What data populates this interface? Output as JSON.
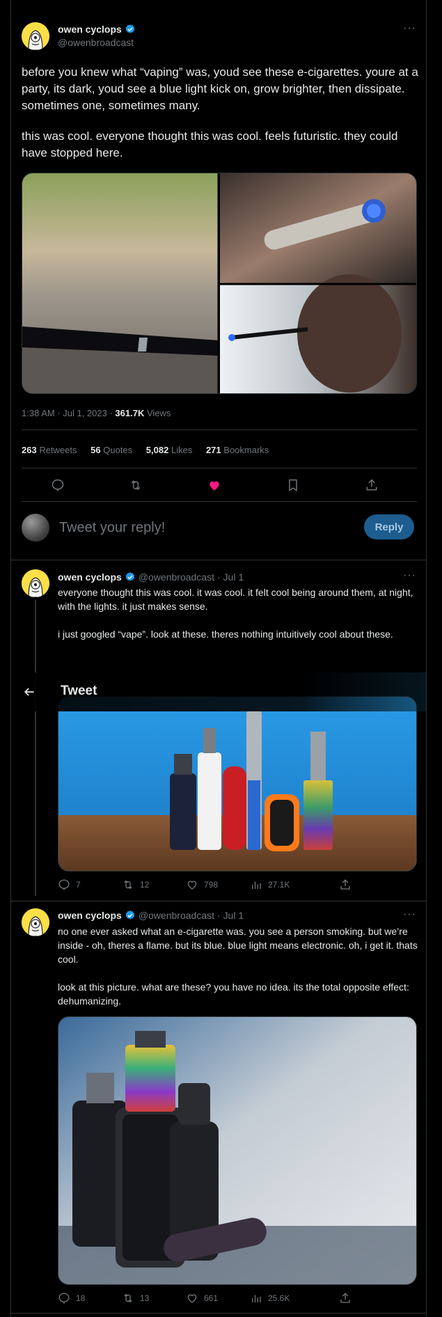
{
  "header": {
    "title": "Tweet"
  },
  "main_tweet": {
    "name": "owen cyclops",
    "handle": "@owenbroadcast",
    "text_p1": "before you knew what “vaping” was, youd see these e-cigarettes. youre at a party, its dark, youd see a blue light kick on, grow brighter, then dissipate. sometimes one, sometimes many.",
    "text_p2": "this was cool. everyone thought this was cool. feels futuristic. they could have stopped here.",
    "timestamp": "1:38 AM · Jul 1, 2023 · ",
    "views_count": "361.7K",
    "views_label": " Views",
    "stats": {
      "retweets_count": "263",
      "retweets_label": "Retweets",
      "quotes_count": "56",
      "quotes_label": "Quotes",
      "likes_count": "5,082",
      "likes_label": "Likes",
      "bookmarks_count": "271",
      "bookmarks_label": "Bookmarks"
    }
  },
  "reply_box": {
    "placeholder": "Tweet your reply!",
    "button_label": "Reply"
  },
  "reply1": {
    "name": "owen cyclops",
    "handle": "@owenbroadcast",
    "date": "· Jul 1",
    "text_p1": "everyone thought this was cool. it was cool. it felt cool being around them, at night, with the lights. it just makes sense.",
    "text_p2": "i just googled “vape”. look at these. theres nothing intuitively cool about these.",
    "replies": "7",
    "retweets": "12",
    "likes": "798",
    "views": "27.1K"
  },
  "reply2": {
    "name": "owen cyclops",
    "handle": "@owenbroadcast",
    "date": "· Jul 1",
    "text_p1": "no one ever asked what an e-cigarette was. you see a person smoking. but we’re inside - oh, theres a flame. but its blue. blue light means electronic. oh, i get it. thats cool.",
    "text_p2": "look at this picture. what are these? you have no idea. its the total opposite effect: dehumanizing.",
    "replies": "18",
    "retweets": "13",
    "likes": "661",
    "views": "25.6K"
  },
  "icons": [
    "back-arrow-icon",
    "verified-icon",
    "more-icon",
    "reply-icon",
    "retweet-icon",
    "like-icon",
    "bookmark-icon",
    "share-icon",
    "views-icon"
  ],
  "colors": {
    "accent": "#1d9bf0",
    "like": "#f91880",
    "reply_button": "#1d5d8f",
    "background": "#000000"
  }
}
